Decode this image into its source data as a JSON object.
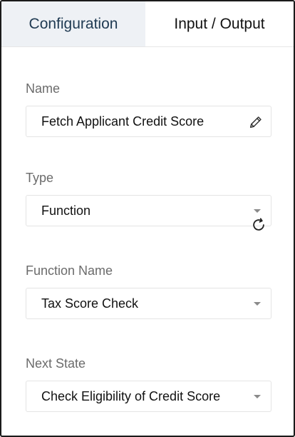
{
  "tabs": {
    "configuration": "Configuration",
    "input_output": "Input / Output"
  },
  "fields": {
    "name": {
      "label": "Name",
      "value": "Fetch Applicant Credit Score",
      "icon": "pencil-icon"
    },
    "type": {
      "label": "Type",
      "value": "Function"
    },
    "function_name": {
      "label": "Function Name",
      "value": "Tax Score Check",
      "icon": "refresh-icon"
    },
    "next_state": {
      "label": "Next State",
      "value": "Check Eligibility of Credit Score"
    }
  },
  "colors": {
    "active_tab_bg": "#eef1f5",
    "active_tab_text": "#1f3a52",
    "label_text": "#6b6b6b"
  }
}
